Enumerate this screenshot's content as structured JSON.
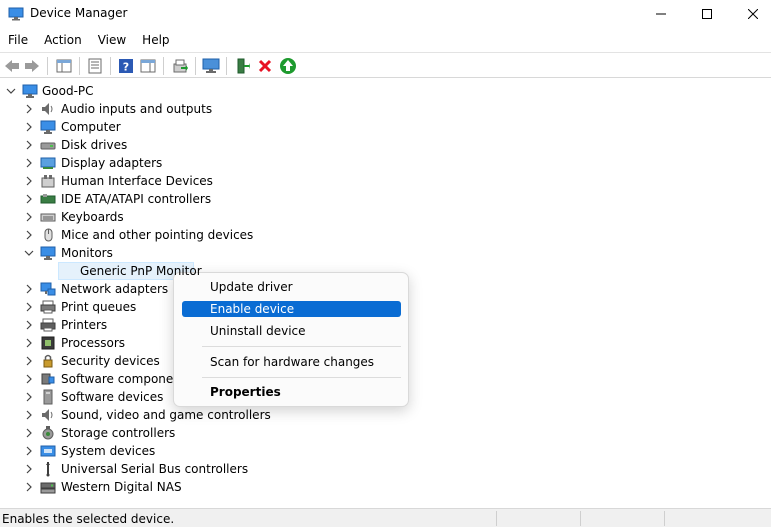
{
  "window": {
    "title": "Device Manager",
    "minimize_label": "Minimize",
    "maximize_label": "Maximize",
    "close_label": "Close"
  },
  "menu": [
    "File",
    "Action",
    "View",
    "Help"
  ],
  "toolbar": {
    "buttons": [
      "back-icon",
      "forward-icon",
      "show-hide-console-tree-icon",
      "properties-icon",
      "help-icon",
      "action-pane-icon",
      "update-driver-icon",
      "scan-hardware-icon",
      "add-legacy-icon",
      "uninstall-icon",
      "enable-device-icon"
    ],
    "colors": {
      "uninstall": "#e81123",
      "enable": "#1e9a2e"
    }
  },
  "tree": {
    "root": "Good-PC",
    "categories": [
      {
        "label": "Audio inputs and outputs",
        "icon": "speaker-icon",
        "expanded": false
      },
      {
        "label": "Computer",
        "icon": "computer-icon",
        "expanded": false
      },
      {
        "label": "Disk drives",
        "icon": "disk-icon",
        "expanded": false
      },
      {
        "label": "Display adapters",
        "icon": "display-adapter-icon",
        "expanded": false
      },
      {
        "label": "Human Interface Devices",
        "icon": "hid-icon",
        "expanded": false
      },
      {
        "label": "IDE ATA/ATAPI controllers",
        "icon": "ide-icon",
        "expanded": false
      },
      {
        "label": "Keyboards",
        "icon": "keyboard-icon",
        "expanded": false
      },
      {
        "label": "Mice and other pointing devices",
        "icon": "mouse-icon",
        "expanded": false
      },
      {
        "label": "Monitors",
        "icon": "monitor-icon",
        "expanded": true,
        "children": [
          "Generic PnP Monitor"
        ]
      },
      {
        "label": "Network adapters",
        "icon": "network-icon",
        "expanded": false
      },
      {
        "label": "Print queues",
        "icon": "print-queue-icon",
        "expanded": false
      },
      {
        "label": "Printers",
        "icon": "printer-icon",
        "expanded": false
      },
      {
        "label": "Processors",
        "icon": "processor-icon",
        "expanded": false
      },
      {
        "label": "Security devices",
        "icon": "security-icon",
        "expanded": false
      },
      {
        "label": "Software component",
        "icon": "software-component-icon",
        "expanded": false
      },
      {
        "label": "Software devices",
        "icon": "software-device-icon",
        "expanded": false
      },
      {
        "label": "Sound, video and game controllers",
        "icon": "sound-icon",
        "expanded": false
      },
      {
        "label": "Storage controllers",
        "icon": "storage-icon",
        "expanded": false
      },
      {
        "label": "System devices",
        "icon": "system-icon",
        "expanded": false
      },
      {
        "label": "Universal Serial Bus controllers",
        "icon": "usb-icon",
        "expanded": false
      },
      {
        "label": "Western Digital NAS",
        "icon": "nas-icon",
        "expanded": false
      }
    ]
  },
  "context_menu": {
    "items": [
      {
        "label": "Update driver",
        "highlighted": false,
        "bold": false
      },
      {
        "label": "Enable device",
        "highlighted": true,
        "bold": false
      },
      {
        "label": "Uninstall device",
        "highlighted": false,
        "bold": false
      },
      {
        "label": "Scan for hardware changes",
        "highlighted": false,
        "bold": false
      },
      {
        "label": "Properties",
        "highlighted": false,
        "bold": true
      }
    ]
  },
  "status": {
    "text": "Enables the selected device."
  },
  "colors": {
    "highlight": "#0a6cd3",
    "selection": "#e5f1fb"
  }
}
